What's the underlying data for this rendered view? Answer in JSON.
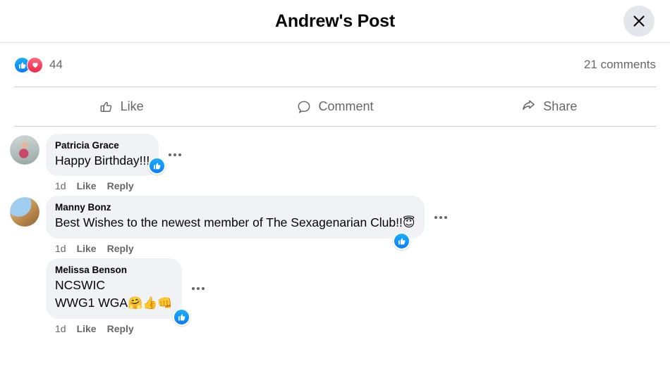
{
  "header": {
    "title": "Andrew's Post",
    "close_icon": "close-icon"
  },
  "reactions": {
    "like_icon": "thumbs-up-icon",
    "love_icon": "heart-icon",
    "count": "44",
    "comments_count": "21 comments"
  },
  "actions": [
    {
      "label": "Like",
      "icon": "thumbs-up-outline-icon"
    },
    {
      "label": "Comment",
      "icon": "comment-bubble-icon"
    },
    {
      "label": "Share",
      "icon": "share-arrow-icon"
    }
  ],
  "comments": [
    {
      "author": "Patricia Grace",
      "text": "Happy Birthday!!!",
      "time": "1d",
      "like_label": "Like",
      "reply_label": "Reply",
      "avatar": "patricia-avatar",
      "has_like_badge": true,
      "menu_icon": "more-options-icon"
    },
    {
      "author": "Manny Bonz",
      "text": "Best Wishes to the newest member of The Sexagenarian Club!!",
      "emoji": "😇",
      "time": "1d",
      "like_label": "Like",
      "reply_label": "Reply",
      "avatar": "manny-avatar",
      "has_like_badge": true,
      "menu_icon": "more-options-icon"
    },
    {
      "author": "Melissa Benson",
      "line1": "NCSWIC",
      "line2": "WWG1 WGA",
      "emoji": "🤗👍👊",
      "time": "1d",
      "like_label": "Like",
      "reply_label": "Reply",
      "avatar": "melissa-avatar",
      "has_like_badge": true,
      "menu_icon": "more-options-icon"
    }
  ],
  "colors": {
    "brand_blue": "#0a7cff",
    "love_red": "#f02849",
    "bubble_bg": "#f0f2f5",
    "secondary_text": "#65676b",
    "primary_text": "#050505"
  }
}
